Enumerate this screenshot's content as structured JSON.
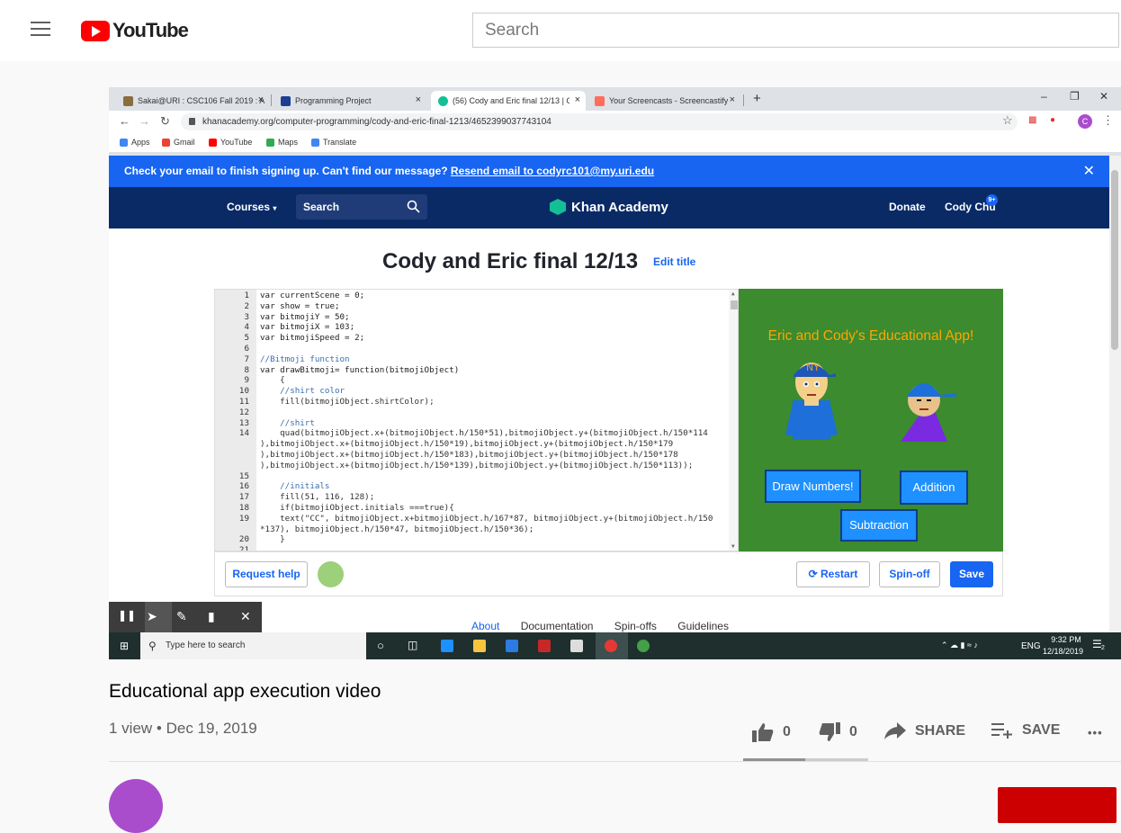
{
  "youtube": {
    "search_placeholder": "Search",
    "logo_text": "YouTube"
  },
  "browser": {
    "tabs": [
      {
        "label": "Sakai@URI : CSC106 Fall 2019 : A",
        "close": "×"
      },
      {
        "label": "Programming Project",
        "close": "×"
      },
      {
        "label": "(56) Cody and Eric final 12/13 | C",
        "close": "×"
      },
      {
        "label": "Your Screencasts - Screencastify",
        "close": "×"
      }
    ],
    "new_tab": "+",
    "url": "khanacademy.org/computer-programming/cody-and-eric-final-1213/4652399037743104",
    "bookmarks": [
      "Apps",
      "Gmail",
      "YouTube",
      "Maps",
      "Translate"
    ],
    "profile_initial": "C"
  },
  "khan": {
    "banner_text": "Check your email to finish signing up. Can't find our message? ",
    "banner_link": "Resend email to codyrc101@my.uri.edu",
    "nav": {
      "courses": "Courses",
      "search": "Search",
      "logo": "Khan Academy",
      "donate": "Donate",
      "user": "Cody Chu",
      "badge": "9+"
    },
    "project_title": "Cody and Eric final 12/13",
    "edit_title": "Edit title",
    "code_lines": [
      {
        "n": "1",
        "t": "var currentScene = 0;"
      },
      {
        "n": "2",
        "t": "var show = true;"
      },
      {
        "n": "3",
        "t": "var bitmojiY = 50;"
      },
      {
        "n": "4",
        "t": "var bitmojiX = 103;"
      },
      {
        "n": "5",
        "t": "var bitmojiSpeed = 2;"
      },
      {
        "n": "6",
        "t": ""
      },
      {
        "n": "7",
        "t": "//Bitmoji function"
      },
      {
        "n": "8",
        "t": "var drawBitmoji= function(bitmojiObject)"
      },
      {
        "n": "9",
        "t": "    {"
      },
      {
        "n": "10",
        "t": "    //shirt color"
      },
      {
        "n": "11",
        "t": "    fill(bitmojiObject.shirtColor);"
      },
      {
        "n": "12",
        "t": ""
      },
      {
        "n": "13",
        "t": "    //shirt"
      },
      {
        "n": "14",
        "t": "    quad(bitmojiObject.x+(bitmojiObject.h/150*51),bitmojiObject.y+(bitmojiObject.h/150*114"
      },
      {
        "n": "",
        "t": "),bitmojiObject.x+(bitmojiObject.h/150*19),bitmojiObject.y+(bitmojiObject.h/150*179"
      },
      {
        "n": "",
        "t": "),bitmojiObject.x+(bitmojiObject.h/150*183),bitmojiObject.y+(bitmojiObject.h/150*178"
      },
      {
        "n": "",
        "t": "),bitmojiObject.x+(bitmojiObject.h/150*139),bitmojiObject.y+(bitmojiObject.h/150*113));"
      },
      {
        "n": "15",
        "t": ""
      },
      {
        "n": "16",
        "t": "    //initials"
      },
      {
        "n": "17",
        "t": "    fill(51, 116, 128);"
      },
      {
        "n": "18",
        "t": "    if(bitmojiObject.initials ===true){"
      },
      {
        "n": "19",
        "t": "    text(\"CC\", bitmojiObject.x+bitmojiObject.h/167*87, bitmojiObject.y+(bitmojiObject.h/150"
      },
      {
        "n": "",
        "t": "*137), bitmojiObject.h/150*47, bitmojiObject.h/150*36);"
      },
      {
        "n": "20",
        "t": "    }"
      },
      {
        "n": "21",
        "t": ""
      }
    ],
    "canvas": {
      "title": "Eric and Cody's Educational App!",
      "hat_text": "NY",
      "buttons": [
        "Draw Numbers!",
        "Addition",
        "Subtraction"
      ]
    },
    "request_help": "Request help",
    "restart": "Restart",
    "spinoff": "Spin-off",
    "save": "Save",
    "under_tabs": [
      "About",
      "Documentation",
      "Spin-offs",
      "Guidelines"
    ]
  },
  "taskbar": {
    "search_placeholder": "Type here to search",
    "lang": "ENG",
    "time": "9:32 PM",
    "date": "12/18/2019",
    "notif_count": "2"
  },
  "video": {
    "title": "Educational app execution video",
    "views": "1 view",
    "date": "Dec 19, 2019",
    "likes": "0",
    "dislikes": "0",
    "share": "SHARE",
    "save": "SAVE",
    "more": "•••"
  },
  "colors": {
    "youtube_red": "#ff0000",
    "khan_blue": "#1865f2",
    "khan_navy": "#0a2a66",
    "canvas_green": "#3c8b2e",
    "app_title_orange": "#ffa500"
  }
}
